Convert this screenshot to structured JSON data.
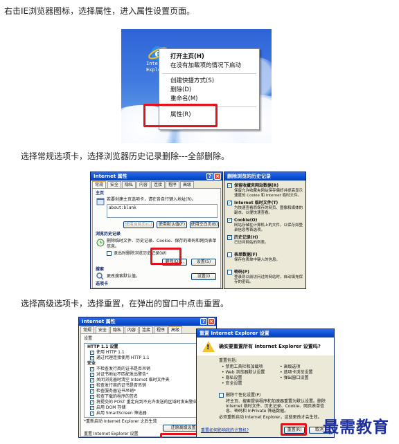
{
  "paragraphs": [
    "右击IE浏览器图标，选择属性，进入属性设置页面。",
    "选择常规选项卡，选择浏览器历史记录删除---全部删除。",
    "选择高级选项卡，选择重置，在弹出的窗口中点击重置。"
  ],
  "shot1": {
    "icon_label_line1": "Internet",
    "icon_label_line2": "Explorer",
    "menu": [
      {
        "label": "打开主页(H)",
        "bold": true
      },
      {
        "label": "在没有加载项的情况下启动"
      },
      {
        "label": "创建快捷方式(S)"
      },
      {
        "label": "删除(D)"
      },
      {
        "label": "重命名(M)"
      },
      {
        "label": "属性(R)"
      }
    ]
  },
  "shot2": {
    "title": "Internet 属性",
    "tabs": [
      "常规",
      "安全",
      "隐私",
      "内容",
      "连接",
      "程序",
      "高级"
    ],
    "homepage_group": "主页",
    "homepage_desc": "若要创建主页选项卡，请在各自行键入地址(R)。",
    "homepage_value": "about:blank",
    "btn_use_current": "使用当前页(C)",
    "btn_use_default": "使用默认值(F)",
    "btn_use_blank": "使用空白页(B)",
    "history_group": "浏览历史记录",
    "history_desc": "删除临时文件、历史记录、Cookie、保存的密码和网页表单信息。",
    "history_checkbox": "退出时删除浏览历史记录(W)",
    "btn_delete": "删除(D)...",
    "btn_settings": "设置(S)",
    "search_group": "搜索",
    "search_desc": "更改搜索默认值。",
    "btn_search_settings": "设置(I)",
    "tabs_group": "选项卡",
    "delete_dialog_title": "删除浏览的历史记录",
    "delete_items": [
      {
        "title": "保留收藏夹网站数据(R)",
        "desc": "保留允许收藏夹网站保存偏好并提高显示速度的 Cookie 和 Internet 临时文件。",
        "checked": true
      },
      {
        "title": "Internet 临时文件(T)",
        "desc": "为快速查看而保存的网页、图像和媒体的副本，以便快速查看。",
        "checked": true
      },
      {
        "title": "Cookie(O)",
        "desc": "网站存储在计算机上的文件，以保存如登录信息等首选项。",
        "checked": true
      },
      {
        "title": "历史记录(H)",
        "desc": "已访问网站的列表。",
        "checked": true
      },
      {
        "title": "表单数据(F)",
        "desc": "保存在表单中键入的信息。",
        "checked": false
      },
      {
        "title": "密码(P)",
        "desc": "登录到以前访问过的网站时，自动填充保存的密码。",
        "checked": false
      }
    ]
  },
  "shot3": {
    "title": "Internet 属性",
    "tabs": [
      "常规",
      "安全",
      "隐私",
      "内容",
      "连接",
      "程序",
      "高级"
    ],
    "settings_label": "设置",
    "tree": [
      "HTTP 1.1 设置",
      "使用 HTTP 1.1",
      "通过代理连接使用 HTTP 1.1",
      "安全",
      "不检查发行商的证书是否吊销",
      "对证书地址不匹配发出警告*",
      "关闭浏览器时清空 Internet 临时文件夹",
      "检查发行商的证书是否吊销",
      "检查服务器证书吊销*",
      "检查下载的程序的签名",
      "将提交的 POST 重定向到不允许发送的区域时发出警告",
      "启用 DOM 存储",
      "启用 SmartScreen 筛选器"
    ],
    "restart_note": "*重新启动 Internet Explorer 之后生效",
    "btn_restore_advanced": "还原高级设置(R)",
    "reset_group": "重置 Internet Explorer 设置",
    "reset_dialog_title": "重置 Internet Explorer 设置",
    "reset_question": "确实要重置所有 Internet Explorer 设置吗?",
    "reset_includes": "重置包括:",
    "reset_list_left": [
      "禁用工具栏和加载项",
      "Web 浏览器默认设置",
      "隐私设置",
      "安全设置"
    ],
    "reset_list_right": [
      "高级选项",
      "选项卡浏览设置",
      "弹出窗口设置"
    ],
    "personal_checkbox": "删除个性化设置(P)",
    "personal_desc": "将主页、搜索提供程序和加速器重置为默认设置。删除 Internet 临时文件、历史记录、Cookie、网页表单信息、密码和 InPrivate 筛选数据。",
    "restart_required": "必须重新启动 Internet Explorer，这些更改才会生效。",
    "help_link": "重置如何影响我的计算机?",
    "btn_reset": "重置(R)",
    "btn_cancel": "取消"
  },
  "watermark": "最需教育",
  "colors": {
    "highlight": "#e3111b",
    "watermark": "#1d2f9c",
    "xp_title": "#0a4fd5"
  }
}
